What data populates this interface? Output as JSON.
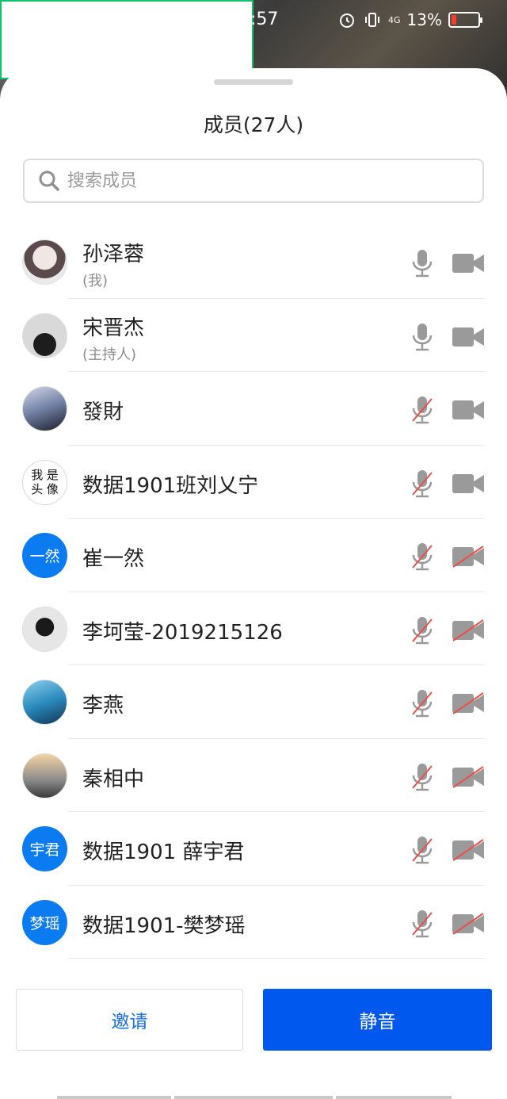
{
  "status": {
    "time": ":57",
    "battery": "13%",
    "network": "4G"
  },
  "sheet": {
    "title": "成员(27人)",
    "search_placeholder": "搜索成员"
  },
  "members": [
    {
      "name": "孙泽蓉",
      "tag": "(我)",
      "mic_on": true,
      "cam_on": true,
      "avatar": "photo"
    },
    {
      "name": "宋晋杰",
      "tag": "(主持人)",
      "mic_on": true,
      "cam_on": true,
      "avatar": "photo"
    },
    {
      "name": "發財",
      "tag": "",
      "mic_on": false,
      "cam_on": true,
      "avatar": "photo"
    },
    {
      "name": "数据1901班刘乂宁",
      "tag": "",
      "mic_on": false,
      "cam_on": true,
      "avatar": "text",
      "avatar_text": [
        "我",
        "是",
        "头",
        "像"
      ]
    },
    {
      "name": "崔一然",
      "tag": "",
      "mic_on": false,
      "cam_on": false,
      "avatar": "blue",
      "avatar_text": "一然"
    },
    {
      "name": "李坷莹-2019215126",
      "tag": "",
      "mic_on": false,
      "cam_on": false,
      "avatar": "photo"
    },
    {
      "name": "李燕",
      "tag": "",
      "mic_on": false,
      "cam_on": false,
      "avatar": "photo"
    },
    {
      "name": "秦相中",
      "tag": "",
      "mic_on": false,
      "cam_on": false,
      "avatar": "photo"
    },
    {
      "name": "数据1901 薛宇君",
      "tag": "",
      "mic_on": false,
      "cam_on": false,
      "avatar": "blue",
      "avatar_text": "宇君"
    },
    {
      "name": "数据1901-樊梦瑶",
      "tag": "",
      "mic_on": false,
      "cam_on": false,
      "avatar": "blue",
      "avatar_text": "梦瑶"
    }
  ],
  "buttons": {
    "invite": "邀请",
    "mute": "静音"
  },
  "colors": {
    "accent": "#0058ef",
    "avatar_blue": "#0a7bf0",
    "icon_gray": "#9a9a9a",
    "muted_slash": "#e8504a"
  }
}
